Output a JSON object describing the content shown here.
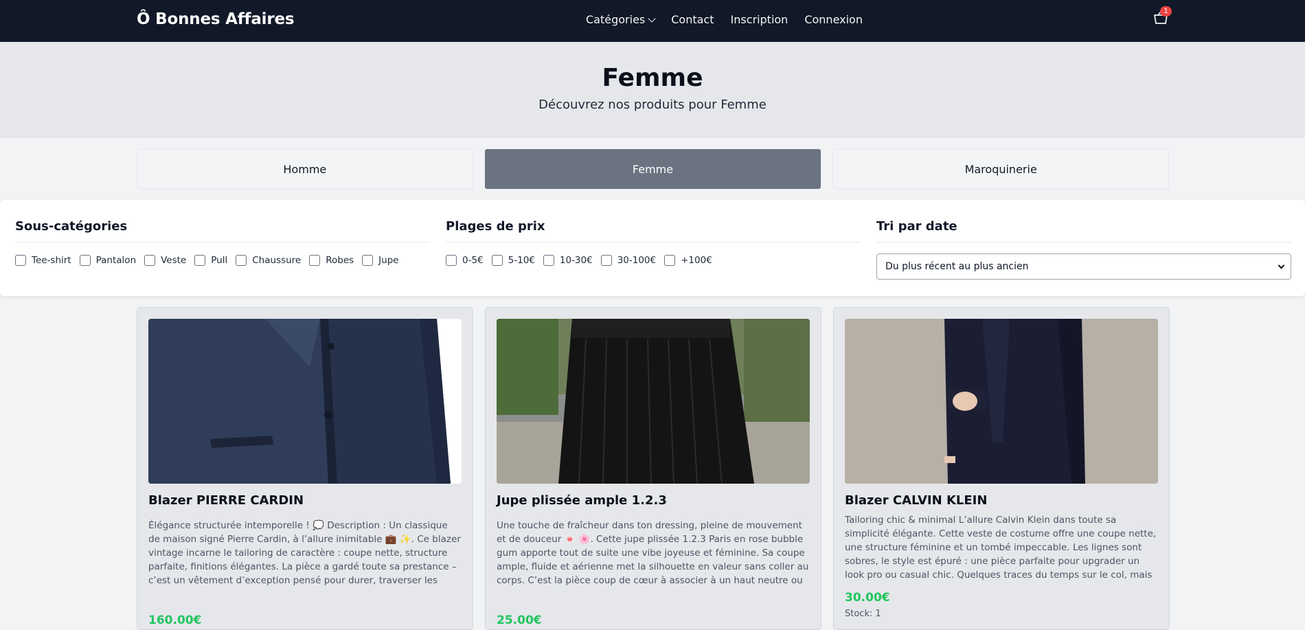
{
  "brand": "Ô Bonnes Affaires",
  "nav": {
    "categories": "Catégories",
    "contact": "Contact",
    "signup": "Inscription",
    "login": "Connexion",
    "cart_count": "1"
  },
  "hero": {
    "title": "Femme",
    "subtitle": "Découvrez nos produits pour Femme"
  },
  "categories": [
    "Homme",
    "Femme",
    "Maroquinerie"
  ],
  "filters": {
    "subcategories_title": "Sous-catégories",
    "subcategories": [
      "Tee-shirt",
      "Pantalon",
      "Veste",
      "Pull",
      "Chaussure",
      "Robes",
      "Jupe"
    ],
    "price_title": "Plages de prix",
    "prices": [
      "0-5€",
      "5-10€",
      "10-30€",
      "30-100€",
      "+100€"
    ],
    "sort_title": "Tri par date",
    "sort_selected": "Du plus récent au plus ancien"
  },
  "products": [
    {
      "name": "Blazer PIERRE CARDIN",
      "description": "Élégance structurée intemporelle ! 💭 Description : Un classique de maison signé Pierre Cardin, à l’allure inimitable 💼 ✨. Ce blazer vintage incarne le tailoring de caractère : coupe nette, structure parfaite, finitions élégantes. La pièce a gardé toute sa prestance – c’est un vêtement d’exception pensé pour durer, traverser les tendances, et imposer une",
      "price": "160.00€"
    },
    {
      "name": "Jupe plissée ample 1.2.3",
      "description": "Une touche de fraîcheur dans ton dressing, pleine de mouvement et de douceur 🍬 🌸. Cette jupe plissée 1.2.3 Paris en rose bubble gum apporte tout de suite une vibe joyeuse et féminine. Sa coupe ample, fluide et aérienne met la silhouette en valeur sans coller au corps. C’est la pièce coup de cœur à associer à un haut neutre ou un perfecto pour twister son",
      "price": "25.00€"
    },
    {
      "name": "Blazer CALVIN KLEIN",
      "description": "Tailoring chic & minimal L’allure Calvin Klein dans toute sa simplicité élégante. Cette veste de costume offre une coupe nette, une structure féminine et un tombé impeccable. Les lignes sont sobres, le style est épuré : une pièce parfaite pour upgrader un look pro ou casual chic. Quelques traces du temps sur le col, mais rien qui enlève son charme ni",
      "price": "30.00€",
      "stock": "Stock: 1"
    }
  ]
}
